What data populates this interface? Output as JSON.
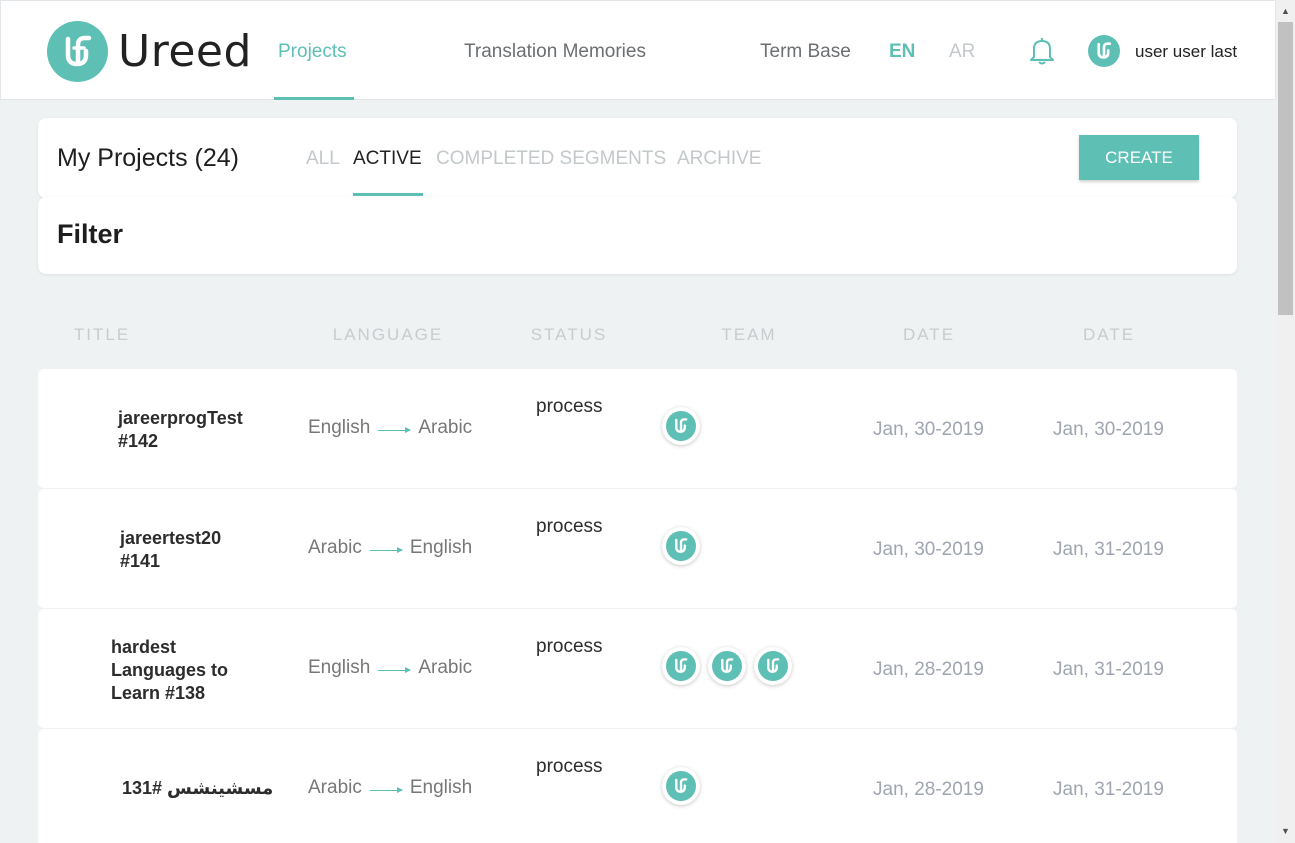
{
  "brand": {
    "name": "Ureed",
    "color": "#5ebfb5"
  },
  "nav": {
    "projects": "Projects",
    "translation_memories": "Translation Memories",
    "term_base": "Term Base",
    "lang_en": "EN",
    "lang_ar": "AR"
  },
  "user": {
    "name": "user user last",
    "icon": "bell-icon"
  },
  "projects_header": {
    "title": "My Projects (24)",
    "tabs": [
      "ALL",
      "ACTIVE",
      "COMPLETED SEGMENTS",
      "ARCHIVE"
    ],
    "active_tab": "ACTIVE",
    "create_label": "CREATE"
  },
  "filter": {
    "title": "Filter"
  },
  "columns": [
    "TITLE",
    "LANGUAGE",
    "STATUS",
    "TEAM",
    "DATE",
    "DATE"
  ],
  "rows": [
    {
      "title_line1": "jareerprogTest",
      "title_line2": "#142",
      "title_line3": "",
      "source": "English",
      "target": "Arabic",
      "status": "process",
      "team_count": 1,
      "date1": "Jan, 30-2019",
      "date2": "Jan, 30-2019"
    },
    {
      "title_line1": "jareertest20",
      "title_line2": "#141",
      "title_line3": "",
      "source": "Arabic",
      "target": "English",
      "status": "process",
      "team_count": 1,
      "date1": "Jan, 30-2019",
      "date2": "Jan, 31-2019"
    },
    {
      "title_line1": "hardest",
      "title_line2": "Languages to",
      "title_line3": "Learn #138",
      "source": "English",
      "target": "Arabic",
      "status": "process",
      "team_count": 3,
      "date1": "Jan, 28-2019",
      "date2": "Jan, 31-2019"
    },
    {
      "title_line1": "مسشينشس #131",
      "title_line2": "",
      "title_line3": "",
      "source": "Arabic",
      "target": "English",
      "status": "process",
      "team_count": 1,
      "date1": "Jan, 28-2019",
      "date2": "Jan, 31-2019"
    }
  ]
}
